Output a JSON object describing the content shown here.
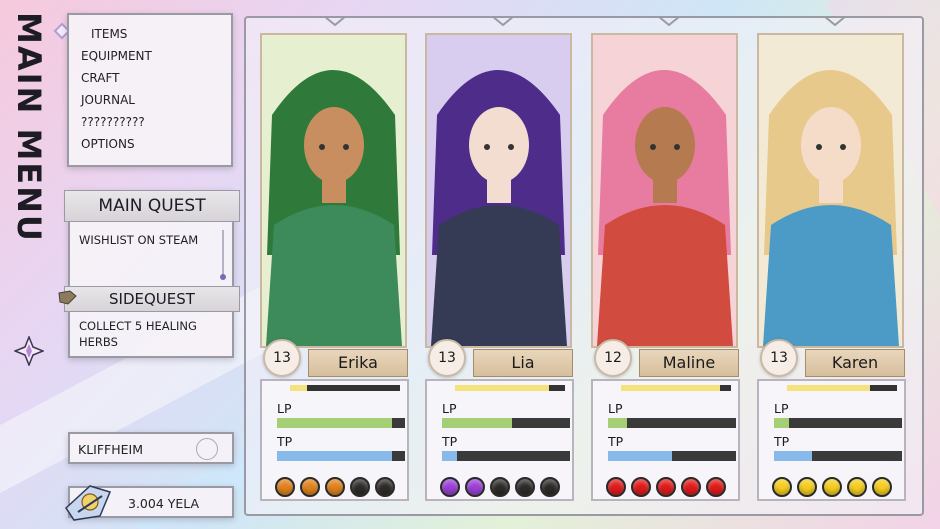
{
  "title": "MAIN MENU",
  "menu": {
    "items": [
      "ITEMS",
      "EQUIPMENT",
      "CRAFT",
      "JOURNAL",
      "??????????",
      "OPTIONS"
    ]
  },
  "quests": {
    "main_heading": "MAIN QUEST",
    "main_text": "WISHLIST ON STEAM",
    "side_heading": "SIDEQUEST",
    "side_text": "COLLECT 5 HEALING HERBS"
  },
  "location": "KLIFFHEIM",
  "money": "3.004 YELA",
  "stat_labels": {
    "lp": "LP",
    "tp": "TP"
  },
  "party": [
    {
      "name": "Erika",
      "level": "13",
      "xp": 0.15,
      "lp": 0.9,
      "tp": 0.9,
      "orbs": {
        "filled": 3,
        "total": 5,
        "color": "#e0821c"
      },
      "portrait": {
        "bg": "#e6f0d0",
        "hair": "#2f7a3b",
        "clothes": "#3d8a5a",
        "skin": "#c98e5f"
      }
    },
    {
      "name": "Lia",
      "level": "13",
      "xp": 0.85,
      "lp": 0.55,
      "tp": 0.12,
      "orbs": {
        "filled": 2,
        "total": 5,
        "color": "#9b3fd6"
      },
      "portrait": {
        "bg": "#d8cdef",
        "hair": "#4d2c8a",
        "clothes": "#363b55",
        "skin": "#f3dcd0"
      }
    },
    {
      "name": "Maline",
      "level": "12",
      "xp": 0.9,
      "lp": 0.15,
      "tp": 0.5,
      "orbs": {
        "filled": 5,
        "total": 5,
        "color": "#e01a1a"
      },
      "portrait": {
        "bg": "#f6d3d6",
        "hair": "#e77ba0",
        "clothes": "#d14b3f",
        "skin": "#b57a4f"
      }
    },
    {
      "name": "Karen",
      "level": "13",
      "xp": 0.75,
      "lp": 0.12,
      "tp": 0.3,
      "orbs": {
        "filled": 5,
        "total": 5,
        "color": "#f4cd1c"
      },
      "portrait": {
        "bg": "#f3ead5",
        "hair": "#e8c98c",
        "clothes": "#4c9bc6",
        "skin": "#f4dcc8"
      }
    }
  ]
}
